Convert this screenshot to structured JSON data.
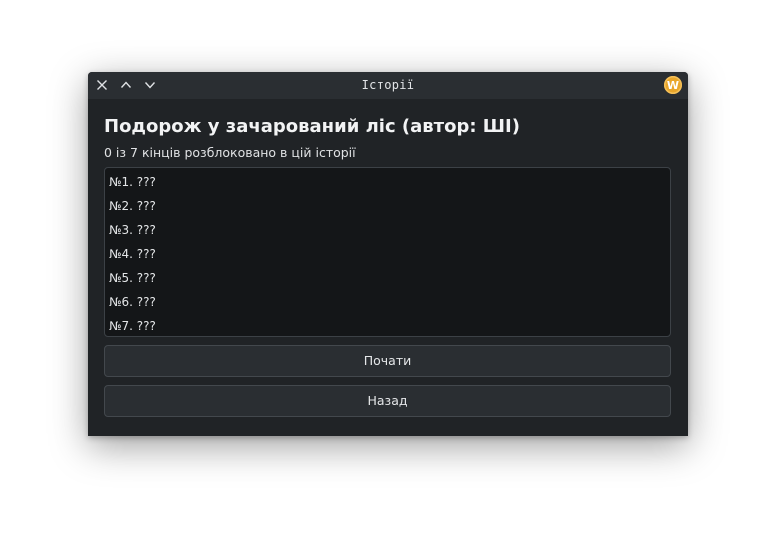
{
  "window": {
    "title": "Історії",
    "app_icon_letter": "W",
    "controls": [
      "close-icon",
      "chevron-up-icon",
      "chevron-down-icon"
    ],
    "accent_color": "#e9a62a"
  },
  "story": {
    "title": "Подорож у зачарований ліс (автор: ШІ)",
    "progress_text": "0 із 7 кінців розблоковано в цій історії",
    "endings": [
      {
        "label": "№1. ???"
      },
      {
        "label": "№2. ???"
      },
      {
        "label": "№3. ???"
      },
      {
        "label": "№4. ???"
      },
      {
        "label": "№5. ???"
      },
      {
        "label": "№6. ???"
      },
      {
        "label": "№7. ???"
      }
    ]
  },
  "buttons": {
    "start_label": "Почати",
    "back_label": "Назад"
  }
}
